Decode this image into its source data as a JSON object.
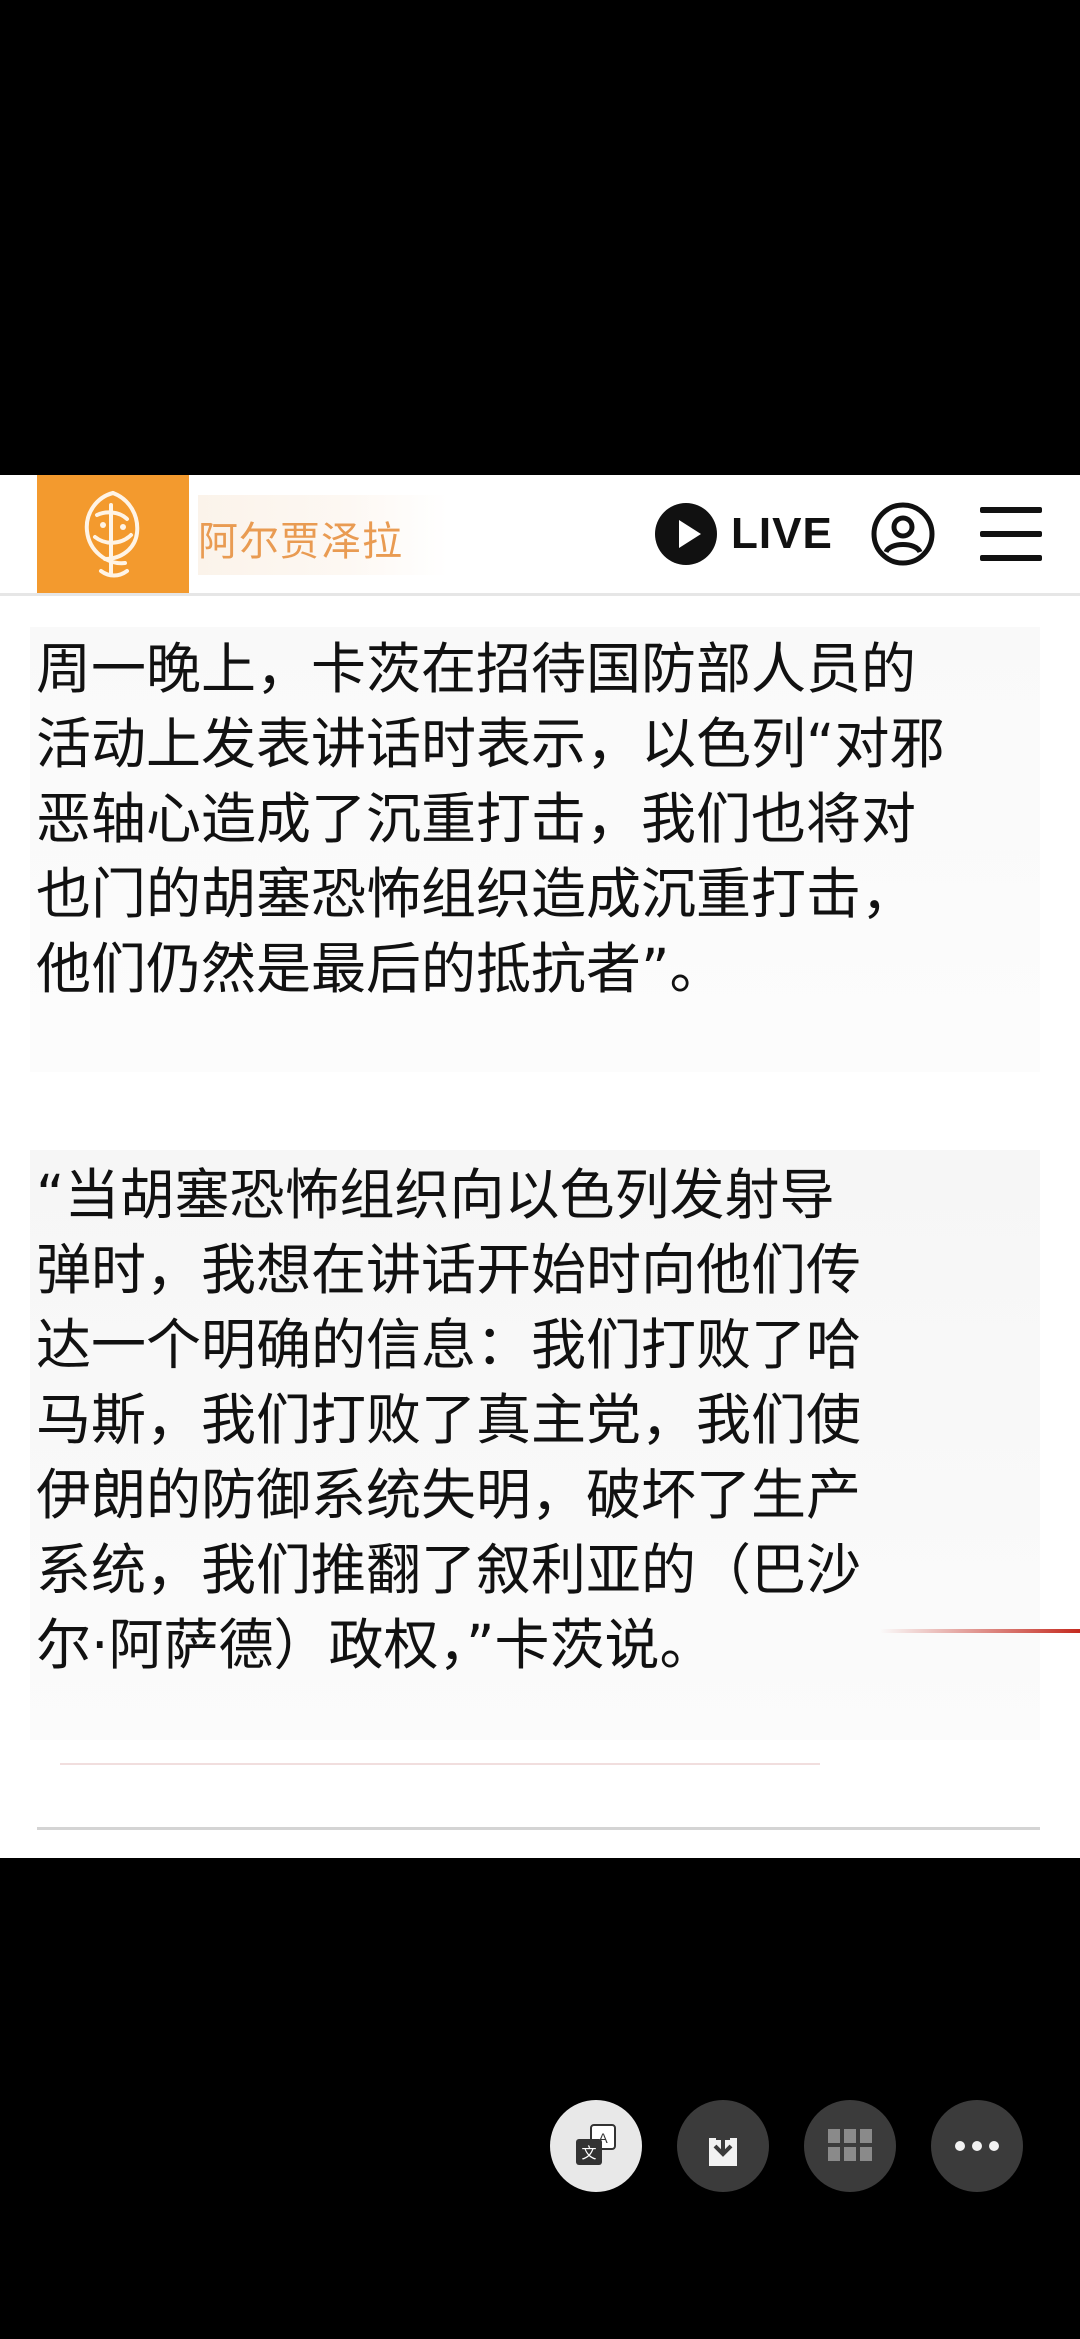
{
  "header": {
    "brand": "阿尔贾泽拉",
    "live_label": "LIVE",
    "logo_icon": "al-jazeera-logo-icon",
    "account_icon": "user-circle-icon",
    "menu_icon": "hamburger-menu-icon",
    "brand_color": "#f39a2e"
  },
  "article": {
    "paragraph_1": "周一晚上，卡茨在招待国防部人员的\n活动上发表讲话时表示，以色列“对邪\n恶轴心造成了沉重打击，我们也将对\n也门的胡塞恐怖组织造成沉重打击，\n他们仍然是最后的抵抗者”。",
    "paragraph_2": "“当胡塞恐怖组织向以色列发射导\n弹时，我想在讲话开始时向他们传\n达一个明确的信息：我们打败了哈\n马斯，我们打败了真主党，我们使\n伊朗的防御系统失明，破坏了生产\n系统，我们推翻了叙利亚的（巴沙\n尔·阿萨德）政权，”卡茨说。"
  },
  "toolbar": {
    "buttons": [
      {
        "name": "translate",
        "icon": "translate-icon"
      },
      {
        "name": "download",
        "icon": "download-icon"
      },
      {
        "name": "apps",
        "icon": "grid-icon"
      },
      {
        "name": "more",
        "icon": "more-dots-icon"
      }
    ]
  }
}
